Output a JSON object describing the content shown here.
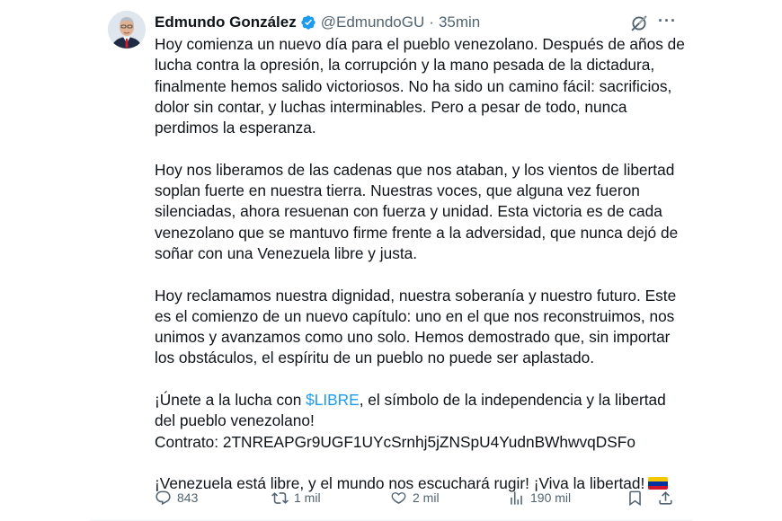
{
  "tweet": {
    "author_name": "Edmundo González",
    "handle": "@EdmundoGU",
    "separator": "·",
    "time": "35min",
    "more_label": "···",
    "paragraphs": [
      "Hoy comienza un nuevo día para el pueblo venezolano. Después de años de\nlucha contra la opresión, la corrupción y la mano pesada de la dictadura,\nfinalmente hemos salido victoriosos. No ha sido un camino fácil: sacrificios,\ndolor sin contar, y luchas interminables. Pero a pesar de todo, nunca\nperdimos la esperanza.",
      "Hoy nos liberamos de las cadenas que nos ataban, y los vientos de libertad\nsoplan fuerte en nuestra tierra. Nuestras voces, que alguna vez fueron\nsilenciadas, ahora resuenan con fuerza y unidad. Esta victoria es de cada\nvenezolano que se mantuvo firme frente a la adversidad, que nunca dejó de\nsoñar con una Venezuela libre y justa.",
      "Hoy reclamamos nuestra dignidad, nuestra soberanía y nuestro futuro. Este\nes el comienzo de un nuevo capítulo: uno en el que nos reconstruimos, nos\nunimos y avanzamos como uno solo. Hemos demostrado que, sin importar\nlos obstáculos, el espíritu de un pueblo no puede ser aplastado."
    ],
    "cta_prefix": "¡Únete a la lucha con ",
    "cashtag": "$LIBRE",
    "cta_suffix": ", el símbolo de la independencia y la libertad\ndel pueblo venezolano!",
    "contract_line": "Contrato: 2TNREAPGr9UGF1UYcSrnhj5jZNSpU4YudnBWhwvqDSFo",
    "closing": "¡Venezuela está libre, y el mundo nos escuchará rugir! ¡Viva la libertad!",
    "flag_colors": [
      "#f6c700",
      "#0033a0",
      "#cf142b"
    ]
  },
  "actions": {
    "replies": "843",
    "reposts": "1 mil",
    "likes": "2 mil",
    "views": "190 mil"
  },
  "colors": {
    "text": "#0f1419",
    "muted": "#536471",
    "link": "#1d9bf0",
    "verified": "#1d9bf0"
  },
  "icons": [
    "verified-badge-icon",
    "grok-icon",
    "more-icon",
    "reply-icon",
    "repost-icon",
    "like-icon",
    "views-icon",
    "bookmark-icon",
    "share-icon"
  ]
}
